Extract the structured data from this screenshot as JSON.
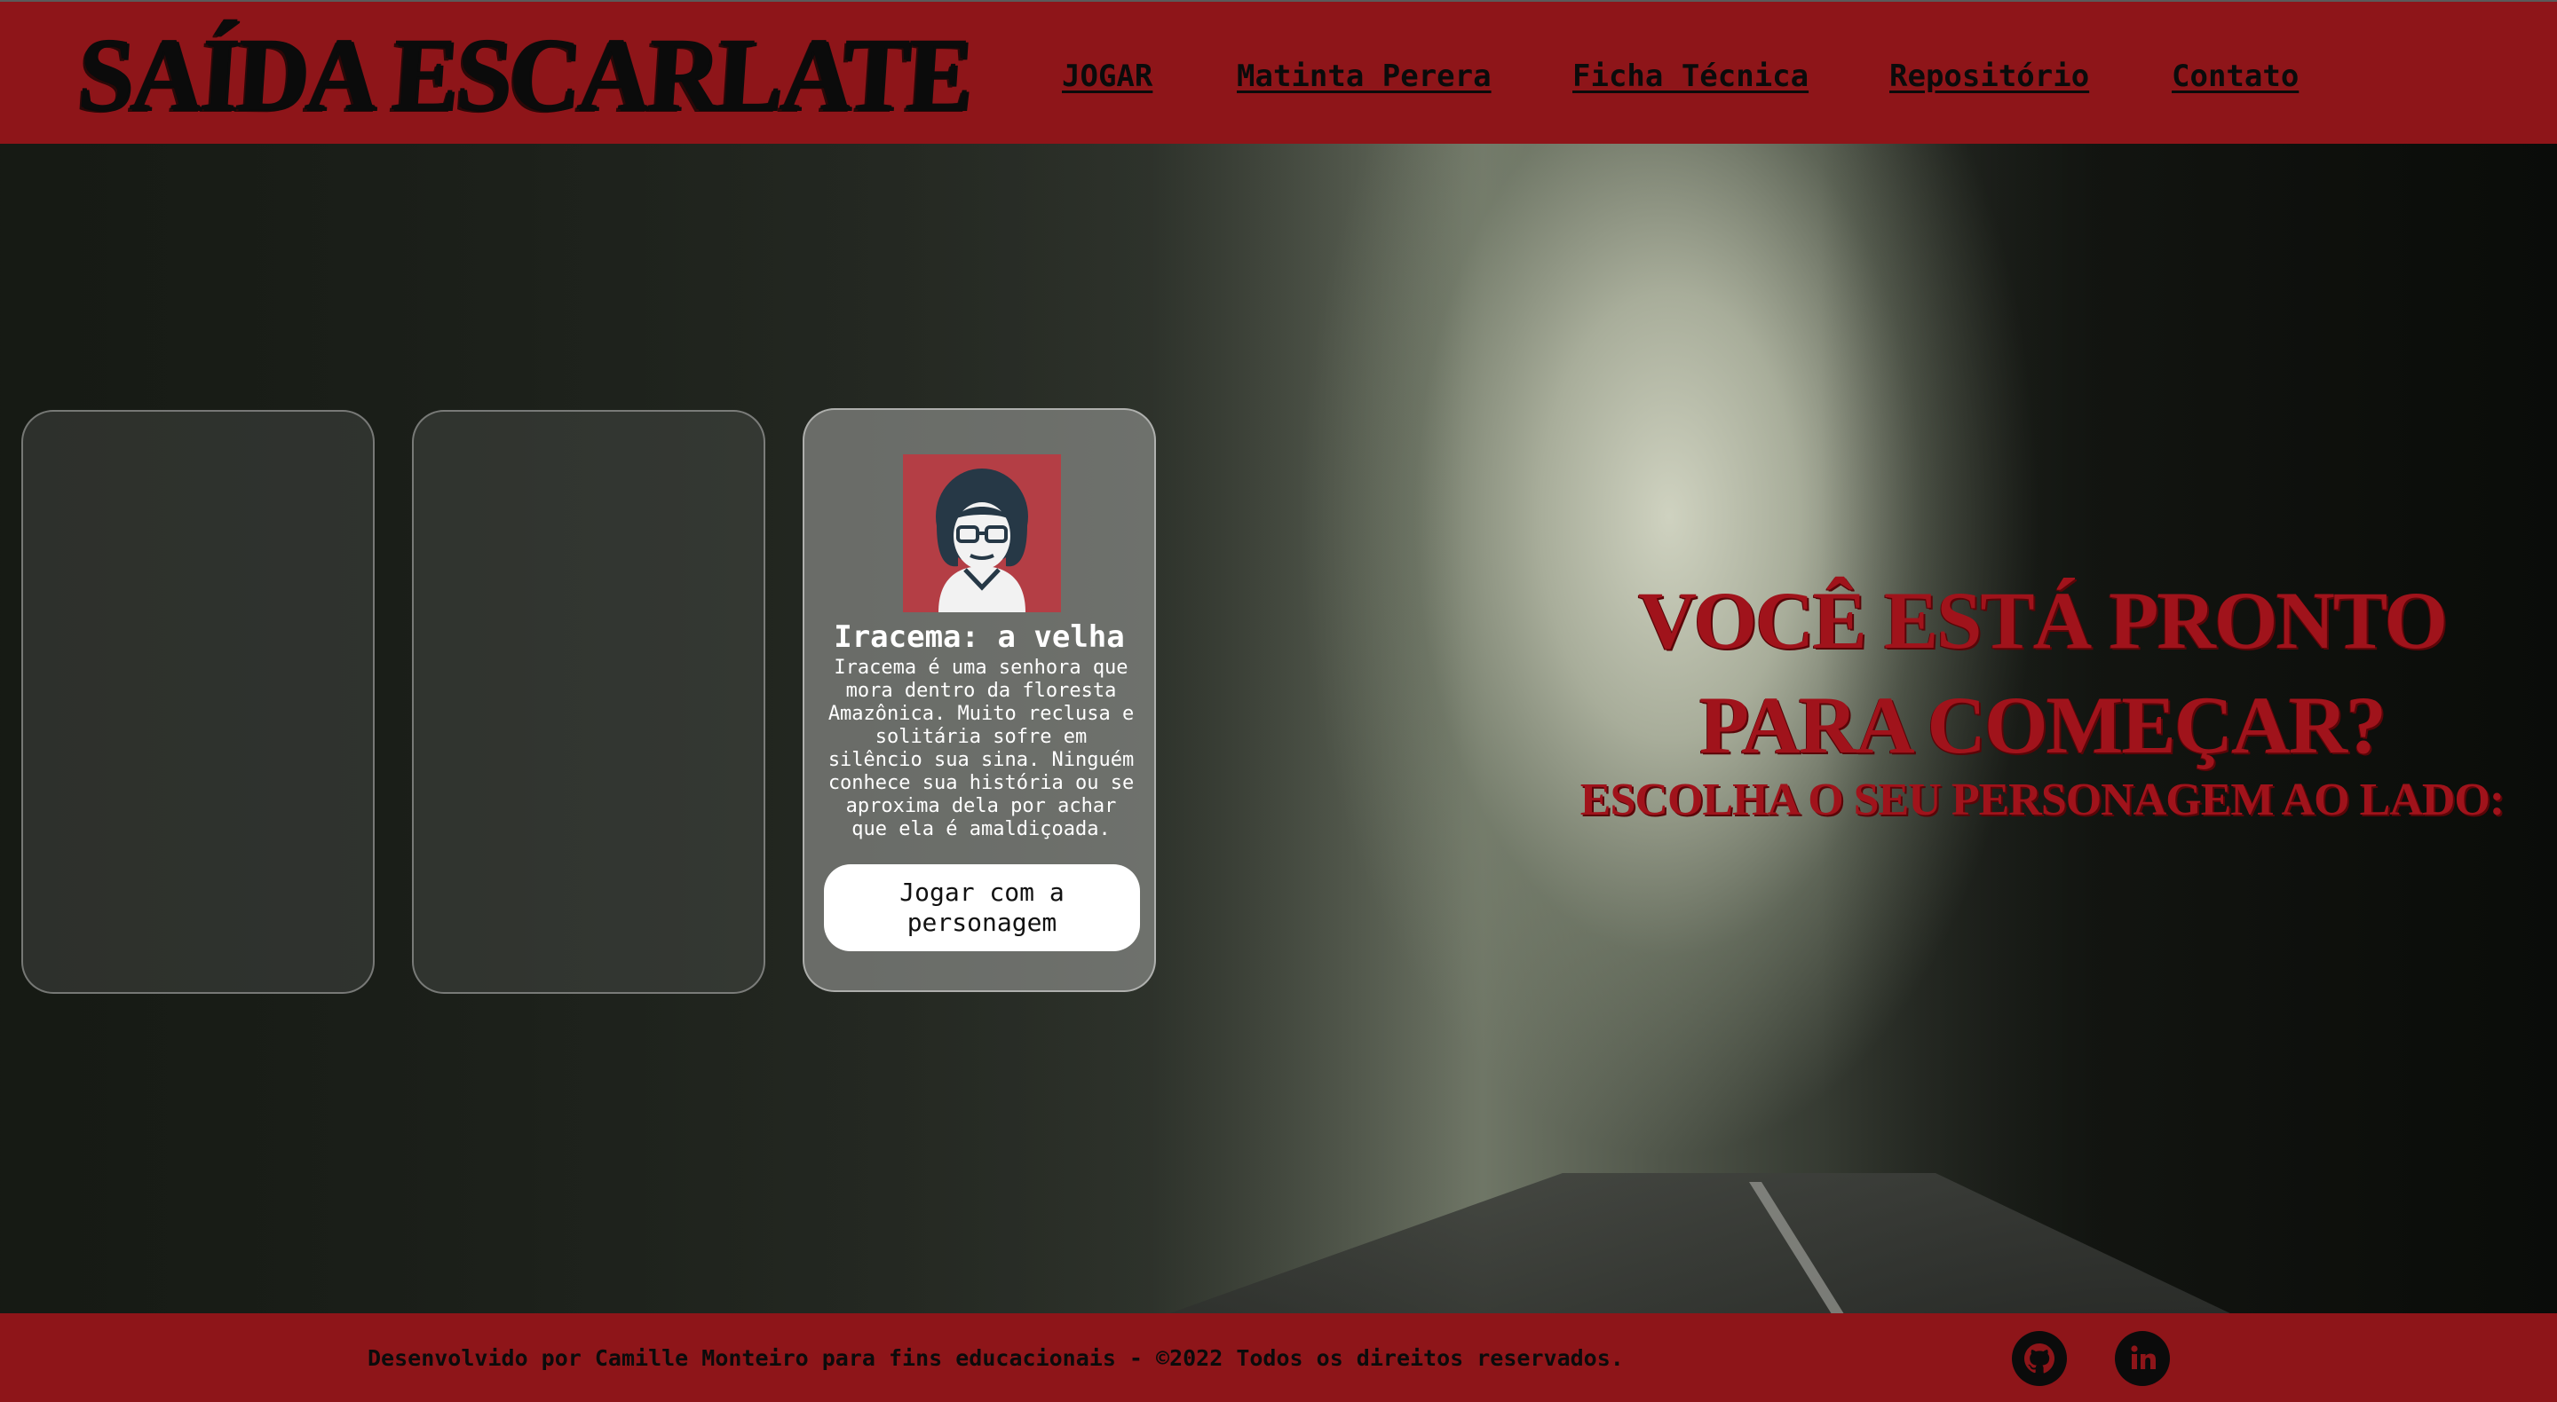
{
  "header": {
    "logo": "SAÍDA ESCARLATE",
    "nav": [
      "JOGAR",
      "Matinta Perera",
      "Ficha Técnica",
      "Repositório",
      "Contato"
    ]
  },
  "cards": [
    {
      "empty": true
    },
    {
      "empty": true
    },
    {
      "title": "Iracema: a velha",
      "description": "Iracema é uma senhora que mora dentro da floresta Amazônica. Muito reclusa e solitária sofre em silêncio sua sina. Ninguém conhece sua história ou se aproxima dela por achar que ela é amaldiçoada.",
      "button": "Jogar com a personagem"
    }
  ],
  "hero": {
    "title": "VOCÊ ESTÁ PRONTO PARA COMEÇAR?",
    "subtitle": "ESCOLHA O SEU PERSONAGEM AO LADO:"
  },
  "footer": {
    "text": "Desenvolvido por Camille Monteiro para fins educacionais - ©2022 Todos os direitos reservados.",
    "icons": [
      "github-icon",
      "linkedin-icon"
    ]
  },
  "colors": {
    "brand_red": "#8e1519",
    "headline_red": "#a0131b",
    "avatar_bg": "#b43e45"
  }
}
